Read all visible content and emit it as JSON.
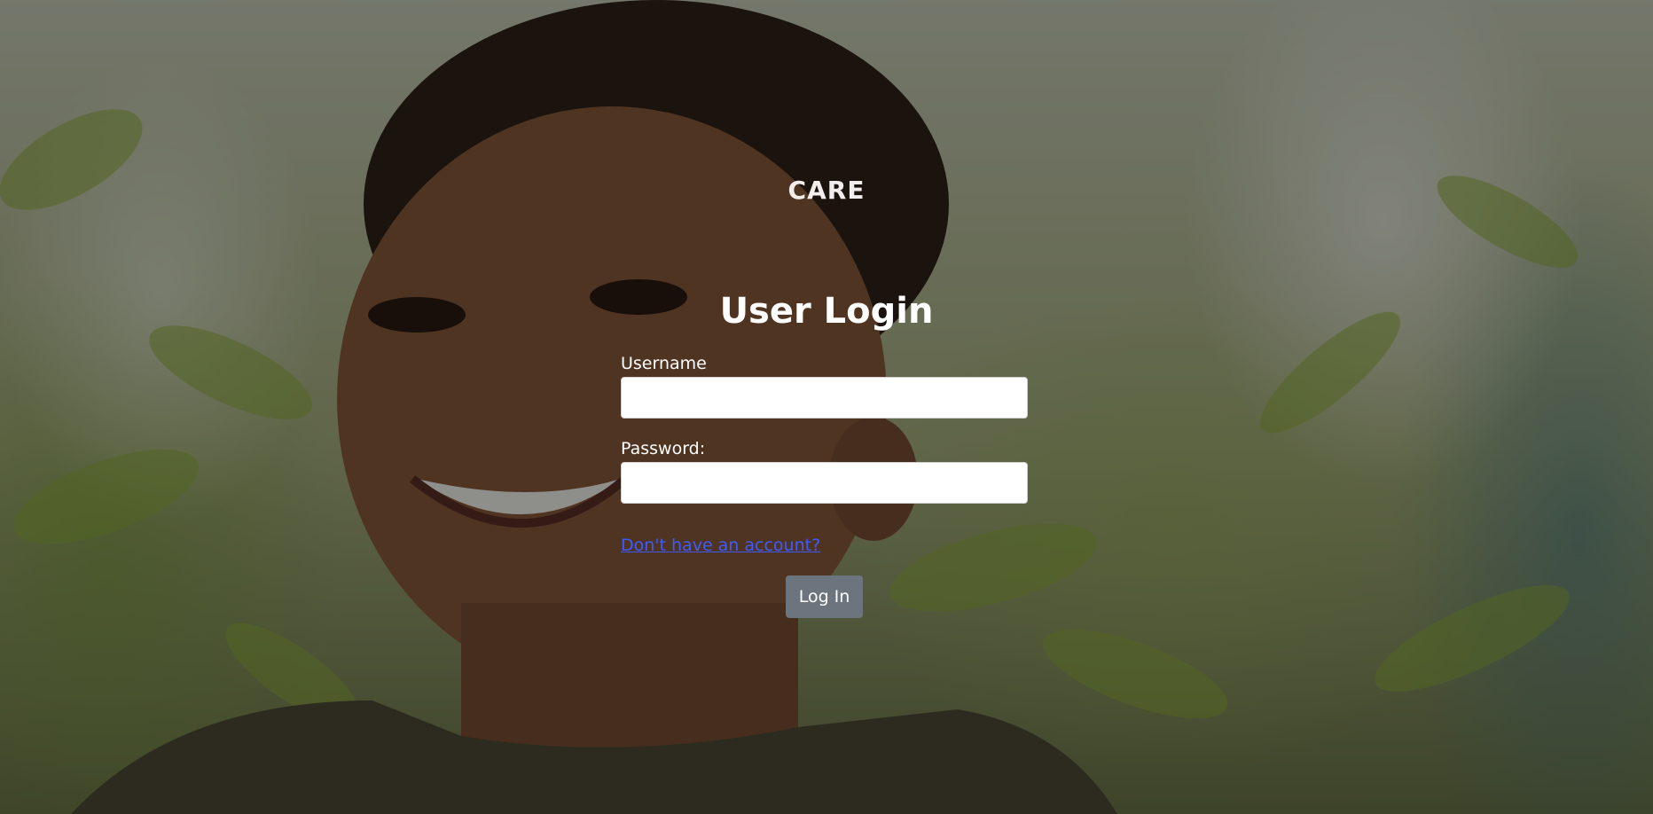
{
  "brand": {
    "name": "CARE"
  },
  "login_form": {
    "title": "User Login",
    "username_label": "Username",
    "username_value": "",
    "password_label": "Password:",
    "password_value": "",
    "signup_link": "Don't have an account?",
    "submit_label": "Log In"
  },
  "colors": {
    "overlay": "#000000",
    "link": "#3d5bff",
    "button": "#6c757d",
    "text": "#ffffff"
  }
}
